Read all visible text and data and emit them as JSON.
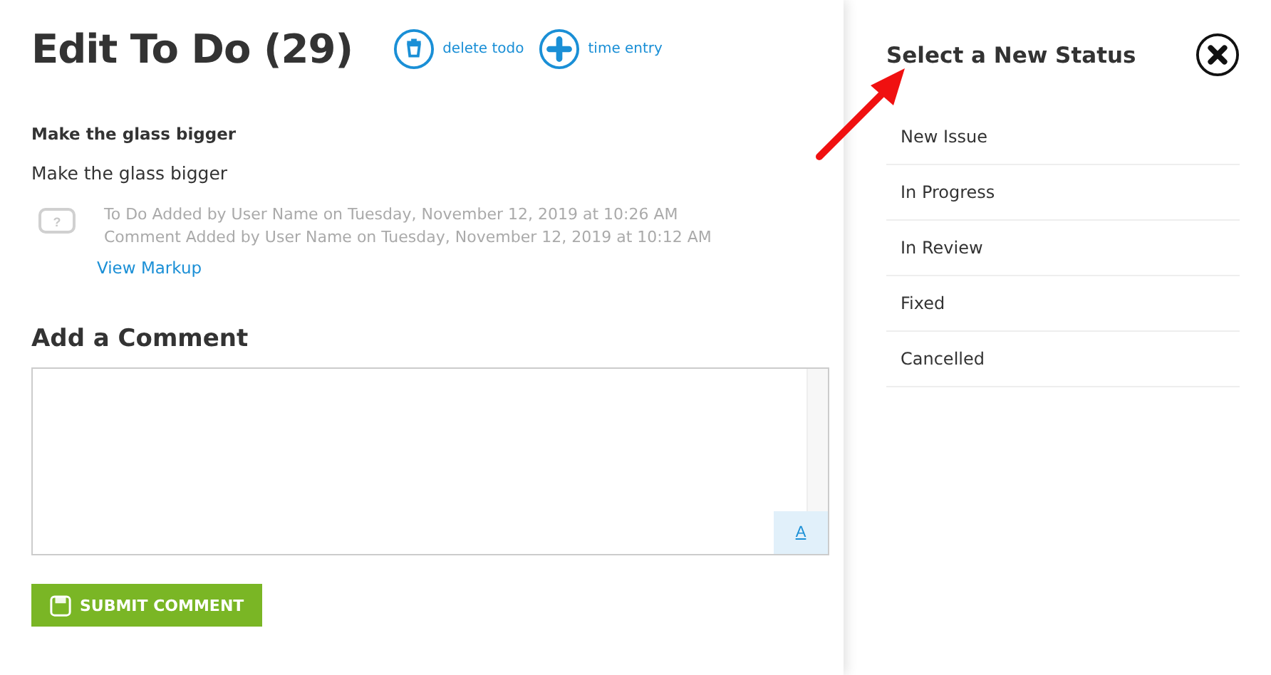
{
  "page": {
    "title": "Edit To Do (29)",
    "actions": [
      {
        "kind": "delete",
        "label": "delete todo"
      },
      {
        "kind": "add",
        "label": "time entry"
      }
    ]
  },
  "todo": {
    "heading": "Make the glass bigger",
    "description": "Make the glass bigger",
    "history": [
      "To Do Added by User Name on Tuesday, November 12, 2019 at 10:26 AM",
      "Comment Added by User Name on Tuesday, November 12, 2019 at 10:12 AM"
    ],
    "history_icon": "?",
    "link": "View Markup"
  },
  "comment": {
    "heading": "Add a Comment",
    "format_button": "A",
    "submit": "SUBMIT COMMENT"
  },
  "status_panel": {
    "title": "Select a New Status",
    "items": [
      {
        "label": "New Issue"
      },
      {
        "label": "In Progress"
      },
      {
        "label": "In Review"
      },
      {
        "label": "Fixed"
      },
      {
        "label": "Cancelled"
      }
    ]
  }
}
